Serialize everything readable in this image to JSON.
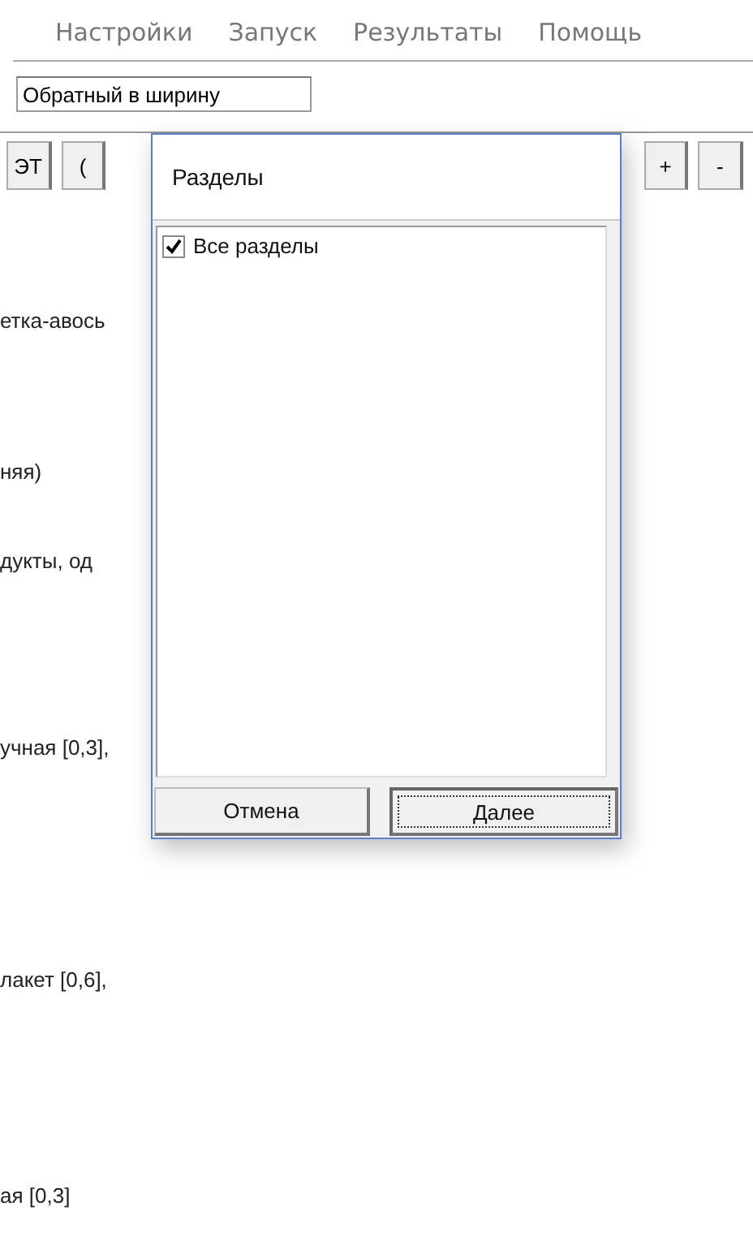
{
  "menu": [
    "Настройки",
    "Запуск",
    "Результаты",
    "Помощь"
  ],
  "mode_field": {
    "value": "Обратный в ширину"
  },
  "toolbar_left": [
    "ЭТ",
    "("
  ],
  "toolbar_right": [
    "+",
    "-"
  ],
  "background_lines": [
    "етка-авось",
    "няя)",
    "дукты, од",
    "учная [0,3],",
    "лакет [0,6],",
    "ая [0,3]"
  ],
  "dialog": {
    "title": "Разделы",
    "items": [
      {
        "label": "Все разделы",
        "checked": true
      }
    ],
    "buttons": [
      {
        "label": "Отмена",
        "default": false
      },
      {
        "label": "Далее",
        "default": true
      }
    ]
  }
}
